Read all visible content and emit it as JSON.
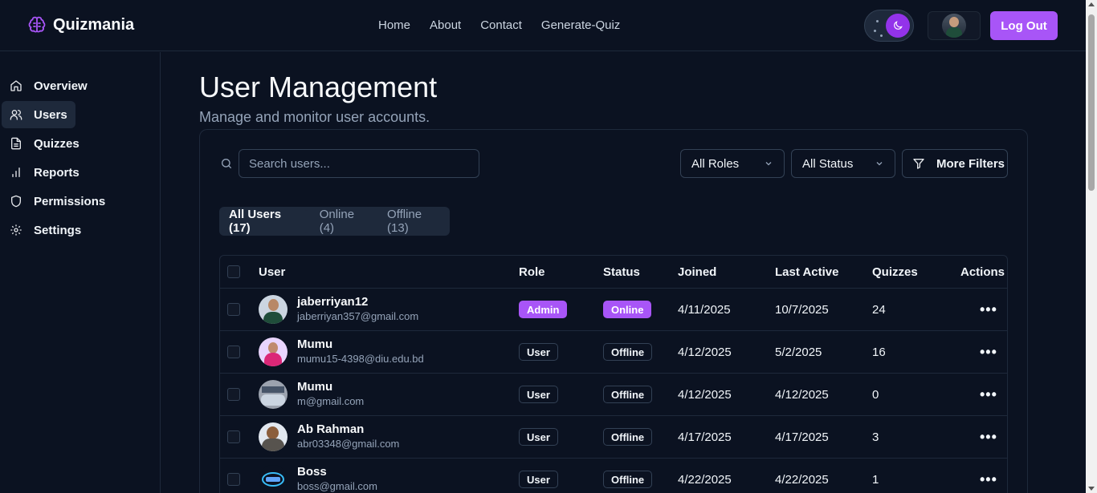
{
  "brand": {
    "name": "Quizmania",
    "icon": "brain-icon",
    "accent": "#a855f7"
  },
  "nav": {
    "items": [
      "Home",
      "About",
      "Contact",
      "Generate-Quiz"
    ]
  },
  "header": {
    "theme_icon": "moon-icon",
    "logout_label": "Log Out"
  },
  "sidebar": {
    "items": [
      {
        "label": "Overview",
        "icon": "home-icon",
        "active": false
      },
      {
        "label": "Users",
        "icon": "users-icon",
        "active": true
      },
      {
        "label": "Quizzes",
        "icon": "document-icon",
        "active": false
      },
      {
        "label": "Reports",
        "icon": "bar-chart-icon",
        "active": false
      },
      {
        "label": "Permissions",
        "icon": "shield-icon",
        "active": false
      },
      {
        "label": "Settings",
        "icon": "gear-icon",
        "active": false
      }
    ]
  },
  "main": {
    "title": "User Management",
    "subtitle": "Manage and monitor user accounts.",
    "search_placeholder": "Search users...",
    "role_filter": "All Roles",
    "status_filter": "All Status",
    "more_filters": "More Filters",
    "tabs": [
      "All Users (17)",
      "Online (4)",
      "Offline (13)"
    ]
  },
  "table": {
    "headers": [
      "User",
      "Role",
      "Status",
      "Joined",
      "Last Active",
      "Quizzes",
      "Actions"
    ],
    "rows": [
      {
        "name": "jaberriyan12",
        "email": "jaberriyan357@gmail.com",
        "role": "Admin",
        "status": "Online",
        "joined": "4/11/2025",
        "last_active": "10/7/2025",
        "quizzes": "24"
      },
      {
        "name": "Mumu",
        "email": "mumu15-4398@diu.edu.bd",
        "role": "User",
        "status": "Offline",
        "joined": "4/12/2025",
        "last_active": "5/2/2025",
        "quizzes": "16"
      },
      {
        "name": "Mumu",
        "email": "m@gmail.com",
        "role": "User",
        "status": "Offline",
        "joined": "4/12/2025",
        "last_active": "4/12/2025",
        "quizzes": "0"
      },
      {
        "name": "Ab Rahman",
        "email": "abr03348@gmail.com",
        "role": "User",
        "status": "Offline",
        "joined": "4/17/2025",
        "last_active": "4/17/2025",
        "quizzes": "3"
      },
      {
        "name": "Boss",
        "email": "boss@gmail.com",
        "role": "User",
        "status": "Offline",
        "joined": "4/22/2025",
        "last_active": "4/22/2025",
        "quizzes": "1"
      }
    ],
    "actions_label": "•••"
  }
}
